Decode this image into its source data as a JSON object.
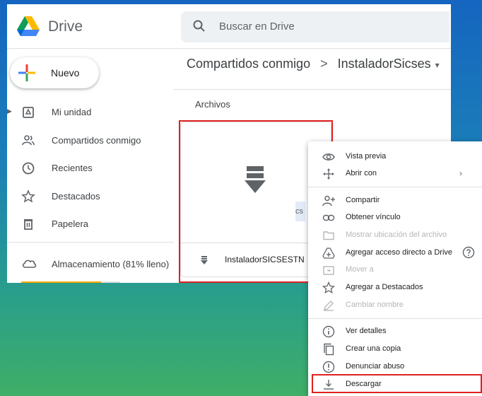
{
  "app": {
    "brand": "Drive",
    "search_placeholder": "Buscar en Drive",
    "new_label": "Nuevo"
  },
  "sidebar": {
    "items": [
      {
        "label": "Mi unidad",
        "icon": "my-drive-icon"
      },
      {
        "label": "Compartidos conmigo",
        "icon": "shared-icon"
      },
      {
        "label": "Recientes",
        "icon": "clock-icon"
      },
      {
        "label": "Destacados",
        "icon": "star-icon"
      },
      {
        "label": "Papelera",
        "icon": "trash-icon"
      }
    ],
    "storage_label": "Almacenamiento (81% lleno)",
    "storage_fraction": 0.81
  },
  "breadcrumb": {
    "parent": "Compartidos conmigo",
    "separator": ">",
    "current": "InstaladorSicses",
    "dropdown": "▾"
  },
  "content": {
    "section_title": "Archivos",
    "file_name": "InstaladorSICSESTN",
    "peek_text": "cs"
  },
  "context_menu": {
    "items": [
      {
        "label": "Vista previa",
        "icon": "eye-icon",
        "disabled": false
      },
      {
        "label": "Abrir con",
        "icon": "move-arrows-icon",
        "disabled": false,
        "submenu": "›"
      },
      {
        "label": "Compartir",
        "icon": "person-add-icon",
        "disabled": false
      },
      {
        "label": "Obtener vínculo",
        "icon": "link-icon",
        "disabled": false
      },
      {
        "label": "Mostrar ubicación del archivo",
        "icon": "folder-icon",
        "disabled": true
      },
      {
        "label": "Agregar acceso directo a Drive",
        "icon": "add-shortcut-icon",
        "disabled": false
      },
      {
        "label": "Mover a",
        "icon": "move-to-icon",
        "disabled": true
      },
      {
        "label": "Agregar a Destacados",
        "icon": "star-icon",
        "disabled": false
      },
      {
        "label": "Cambiar nombre",
        "icon": "pencil-icon",
        "disabled": true
      },
      {
        "label": "Ver detalles",
        "icon": "info-icon",
        "disabled": false
      },
      {
        "label": "Crear una copia",
        "icon": "copy-icon",
        "disabled": false
      },
      {
        "label": "Denunciar abuso",
        "icon": "report-icon",
        "disabled": false
      },
      {
        "label": "Descargar",
        "icon": "download-icon",
        "disabled": false
      }
    ]
  },
  "colors": {
    "highlight": "#e02020",
    "storage_fill": "#f9ab00"
  }
}
